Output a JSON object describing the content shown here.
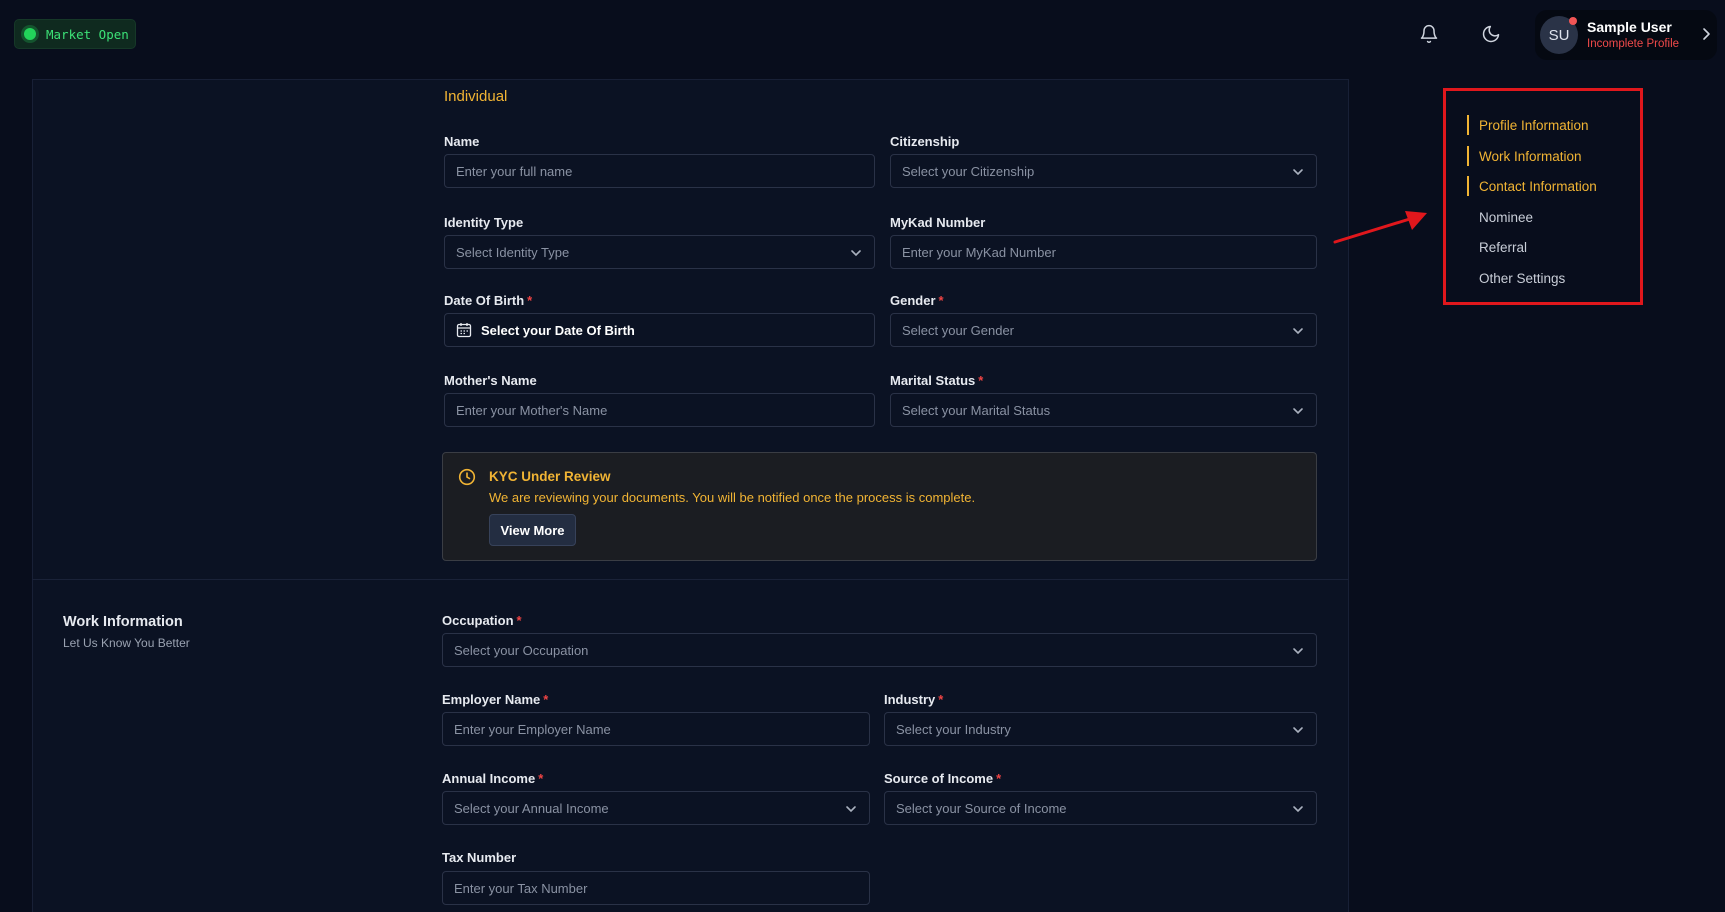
{
  "topbar": {
    "market_status": "Market Open",
    "icons": [
      "bell-icon",
      "moon-icon"
    ],
    "user": {
      "initials": "SU",
      "name": "Sample User",
      "status": "Incomplete Profile"
    }
  },
  "profile_section": {
    "heading": "Individual",
    "fields": {
      "name": {
        "label": "Name",
        "placeholder": "Enter your full name"
      },
      "citizenship": {
        "label": "Citizenship",
        "value": "Select your Citizenship"
      },
      "identity_type": {
        "label": "Identity Type",
        "value": "Select Identity Type"
      },
      "mykad": {
        "label": "MyKad Number",
        "placeholder": "Enter your MyKad Number"
      },
      "dob": {
        "label": "Date Of Birth",
        "value": "Select your Date Of Birth"
      },
      "gender": {
        "label": "Gender",
        "value": "Select your Gender"
      },
      "mother_name": {
        "label": "Mother's Name",
        "placeholder": "Enter your Mother's Name"
      },
      "marital_status": {
        "label": "Marital Status",
        "value": "Select your Marital Status"
      }
    },
    "required_mark": "*"
  },
  "kyc_notice": {
    "title": "KYC Under Review",
    "message": "We are reviewing your documents. You will be notified once the process is complete.",
    "button": "View More"
  },
  "work_section": {
    "title": "Work Information",
    "subtitle": "Let Us Know You Better",
    "fields": {
      "occupation": {
        "label": "Occupation",
        "value": "Select your Occupation"
      },
      "employer_name": {
        "label": "Employer Name",
        "placeholder": "Enter your Employer Name"
      },
      "industry": {
        "label": "Industry",
        "value": "Select your Industry"
      },
      "annual_income": {
        "label": "Annual Income",
        "value": "Select your Annual Income"
      },
      "source_of_income": {
        "label": "Source of Income",
        "value": "Select your Source of Income"
      },
      "tax_number": {
        "label": "Tax Number",
        "placeholder": "Enter your Tax Number"
      }
    }
  },
  "side_nav": {
    "items": [
      {
        "label": "Profile Information",
        "active": true
      },
      {
        "label": "Work Information",
        "active": true
      },
      {
        "label": "Contact Information",
        "active": true
      },
      {
        "label": "Nominee",
        "active": false
      },
      {
        "label": "Referral",
        "active": false
      },
      {
        "label": "Other Settings",
        "active": false
      }
    ]
  },
  "colors": {
    "background": "#080d1c",
    "accent": "#f1b434",
    "required": "#ef4444",
    "market_green": "#22d35a",
    "annotation_red": "#e0171c"
  }
}
